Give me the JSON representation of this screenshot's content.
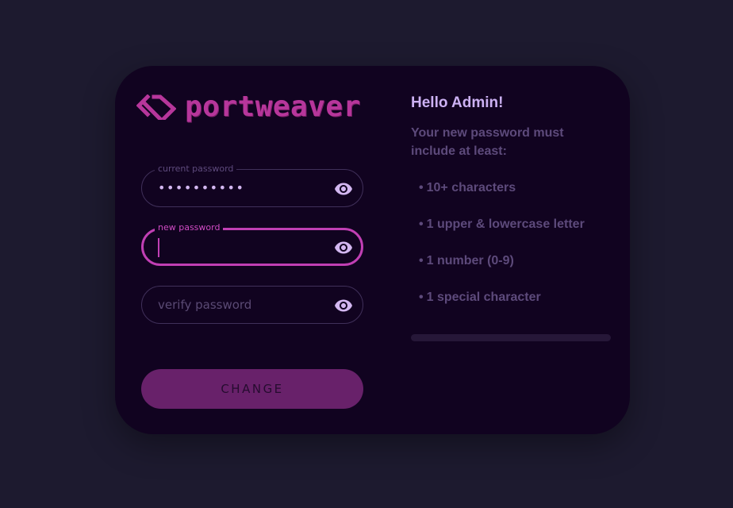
{
  "brand": {
    "name": "portweaver",
    "color": "#b7369b",
    "icon": "diamond-chevrons-icon"
  },
  "form": {
    "current_password": {
      "label": "current password",
      "masked_value": "••••••••••",
      "toggle_icon": "eye-icon"
    },
    "new_password": {
      "label": "new password",
      "value": "",
      "focused": true,
      "toggle_icon": "eye-icon"
    },
    "verify_password": {
      "placeholder": "verify password",
      "value": "",
      "toggle_icon": "eye-icon"
    },
    "submit_label": "CHANGE"
  },
  "info": {
    "greeting": "Hello Admin!",
    "intro": "Your new password must include at least:",
    "bullet": "•",
    "requirements": [
      "10+ characters",
      "1 upper & lowercase letter",
      "1 number (0-9)",
      "1 special character"
    ],
    "strength_fraction": 0
  },
  "colors": {
    "background": "#1d1a2f",
    "card": "#110320",
    "accent": "#c13fb4",
    "button": "#68216a",
    "text_light": "#ccb1f3",
    "text_muted": "#5d4a7b"
  }
}
